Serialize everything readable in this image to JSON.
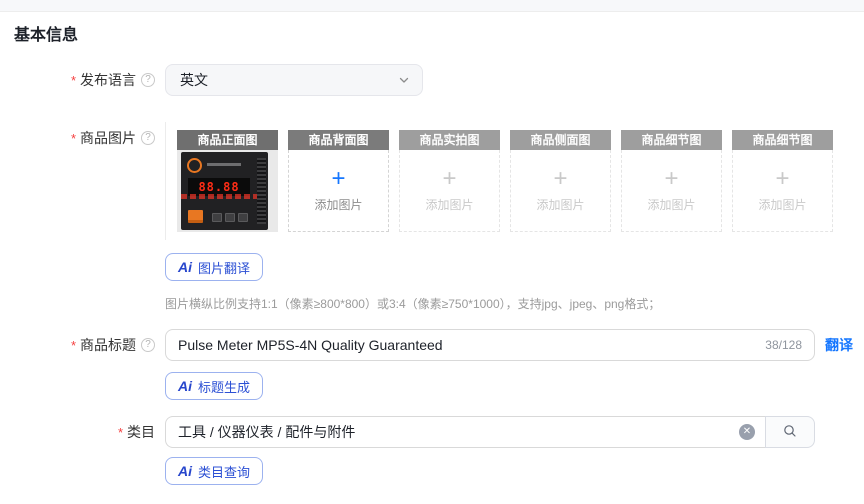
{
  "page": {
    "title": "基本信息"
  },
  "ai": {
    "prefix": "Ai"
  },
  "fields": {
    "language": {
      "label": "发布语言",
      "required": "*",
      "value": "英文"
    },
    "images": {
      "label": "商品图片",
      "required": "*",
      "tiles": [
        {
          "title": "商品正面图",
          "state": "filled",
          "led": "88.88"
        },
        {
          "title": "商品背面图",
          "state": "active",
          "add_label": "添加图片"
        },
        {
          "title": "商品实拍图",
          "state": "disabled",
          "add_label": "添加图片"
        },
        {
          "title": "商品侧面图",
          "state": "disabled",
          "add_label": "添加图片"
        },
        {
          "title": "商品细节图",
          "state": "disabled",
          "add_label": "添加图片"
        },
        {
          "title": "商品细节图",
          "state": "disabled",
          "add_label": "添加图片"
        }
      ],
      "ai_button": "图片翻译",
      "hint": "图片横纵比例支持1:1（像素≥800*800）或3:4（像素≥750*1000），支持jpg、jpeg、png格式；"
    },
    "title": {
      "label": "商品标题",
      "required": "*",
      "value": "Pulse Meter MP5S-4N Quality Guaranteed",
      "counter": "38/128",
      "translate_link": "翻译",
      "ai_button": "标题生成"
    },
    "category": {
      "label": "类目",
      "required": "*",
      "value": "工具 / 仪器仪表 / 配件与附件",
      "ai_button": "类目查询"
    }
  },
  "colors": {
    "accent_blue": "#1677ff",
    "ai_blue": "#2c50d4",
    "required_red": "#f53f3f"
  }
}
